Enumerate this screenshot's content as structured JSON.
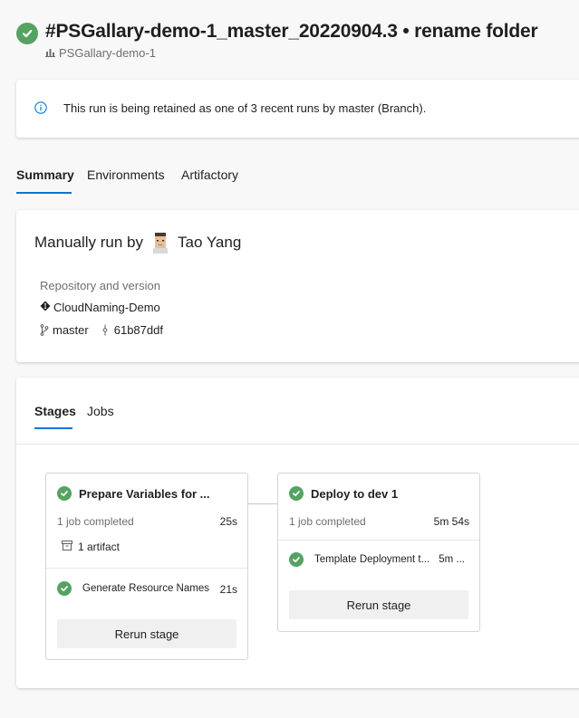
{
  "header": {
    "title": "#PSGallary-demo-1_master_20220904.3 • rename folder",
    "pipeline": "PSGallary-demo-1",
    "status_color": "#55a362"
  },
  "banner": {
    "icon": "info-icon",
    "text": "This run is being retained as one of 3 recent runs by master (Branch)."
  },
  "tabs": [
    {
      "label": "Summary",
      "active": true
    },
    {
      "label": "Environments",
      "active": false
    },
    {
      "label": "Artifactory",
      "active": false
    }
  ],
  "summary": {
    "run_by_prefix": "Manually run by",
    "user": "Tao Yang",
    "repo_label": "Repository and version",
    "repo_name": "CloudNaming-Demo",
    "branch": "master",
    "commit": "61b87ddf"
  },
  "stages_card": {
    "tabs": [
      {
        "label": "Stages",
        "active": true
      },
      {
        "label": "Jobs",
        "active": false
      }
    ],
    "stages": [
      {
        "name": "Prepare Variables for ...",
        "jobs_completed": "1 job completed",
        "duration": "25s",
        "artifact": "1 artifact",
        "job": {
          "name": "Generate Resource Names",
          "duration": "21s"
        },
        "rerun_label": "Rerun stage"
      },
      {
        "name": "Deploy to dev 1",
        "jobs_completed": "1 job completed",
        "duration": "5m 54s",
        "job": {
          "name": "Template Deployment t...",
          "duration": "5m ..."
        },
        "rerun_label": "Rerun stage"
      }
    ]
  },
  "colors": {
    "accent": "#0078d4",
    "success": "#55a362"
  }
}
